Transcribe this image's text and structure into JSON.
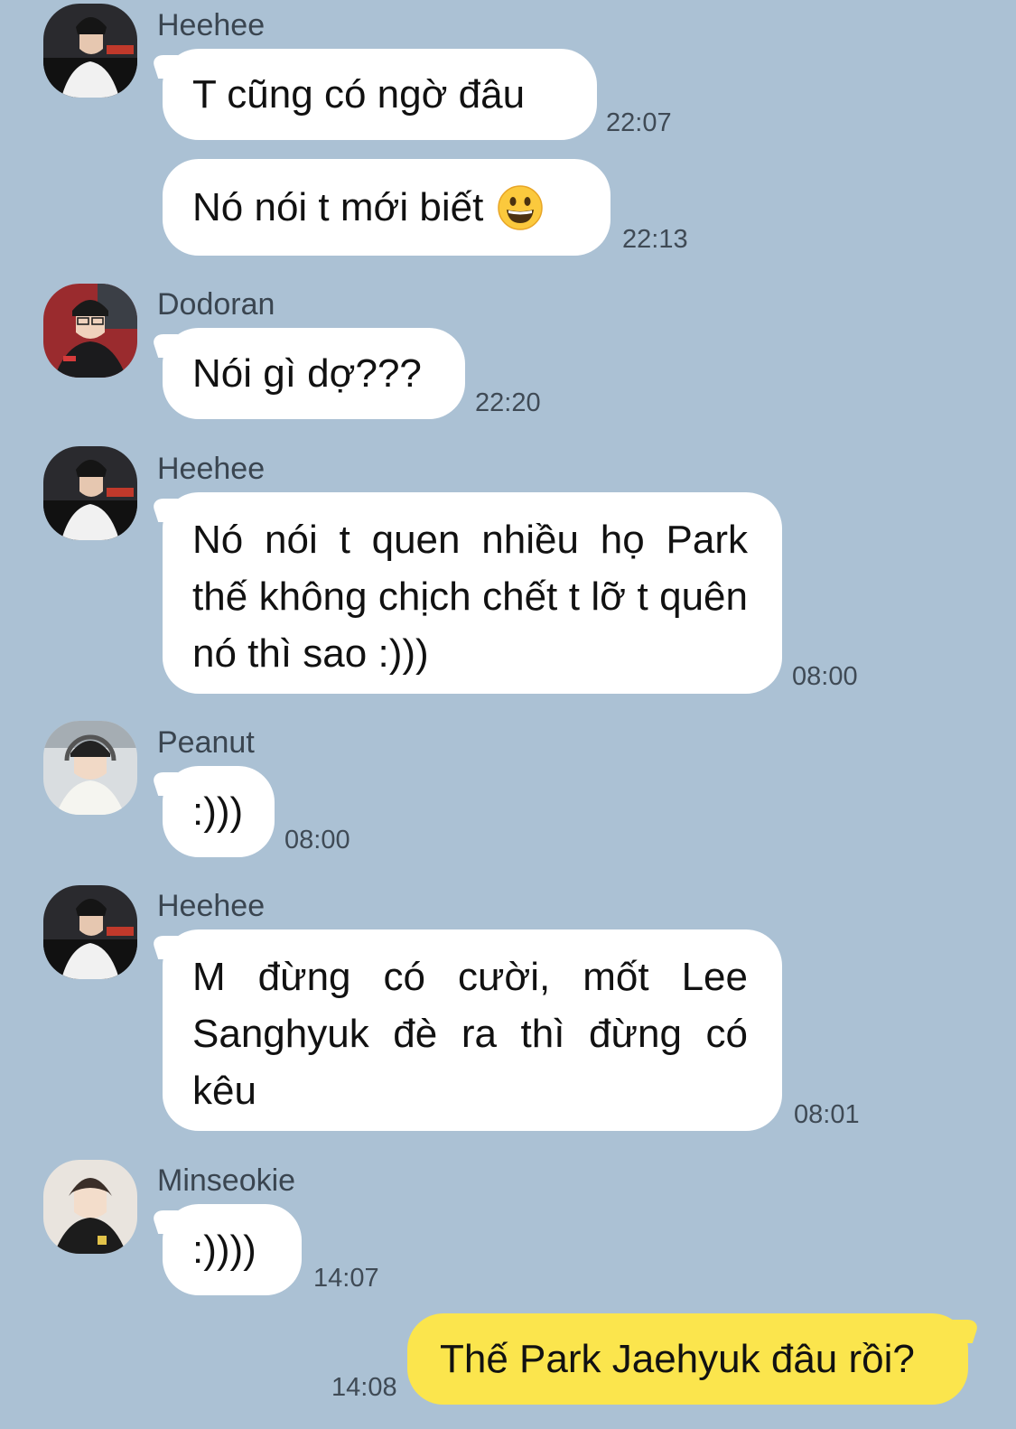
{
  "messages": [
    {
      "sender": "Heehee",
      "text": "T cũng có ngờ đâu",
      "time": "22:07"
    },
    {
      "sender": "",
      "text": "Nó nói t mới biết",
      "emoji": "grinning-face-emoji",
      "time": "22:13"
    },
    {
      "sender": "Dodoran",
      "text": "Nói gì dợ???",
      "time": "22:20"
    },
    {
      "sender": "Heehee",
      "text": "Nó nói t quen nhiều họ Park thế không chịch chết t lỡ t quên nó thì sao :)))",
      "time": "08:00"
    },
    {
      "sender": "Peanut",
      "text": ":)))",
      "time": "08:00"
    },
    {
      "sender": "Heehee",
      "text": "M đừng có cười, mốt Lee Sanghyuk đè ra thì đừng có kêu",
      "time": "08:01"
    },
    {
      "sender": "Minseokie",
      "text": ":))))",
      "time": "14:07"
    },
    {
      "sender": "me",
      "text": "Thế Park Jaehyuk đâu rồi?",
      "time": "14:08"
    }
  ],
  "colors": {
    "background": "#abc1d4",
    "incoming_bubble": "#ffffff",
    "outgoing_bubble": "#fbe54d"
  }
}
